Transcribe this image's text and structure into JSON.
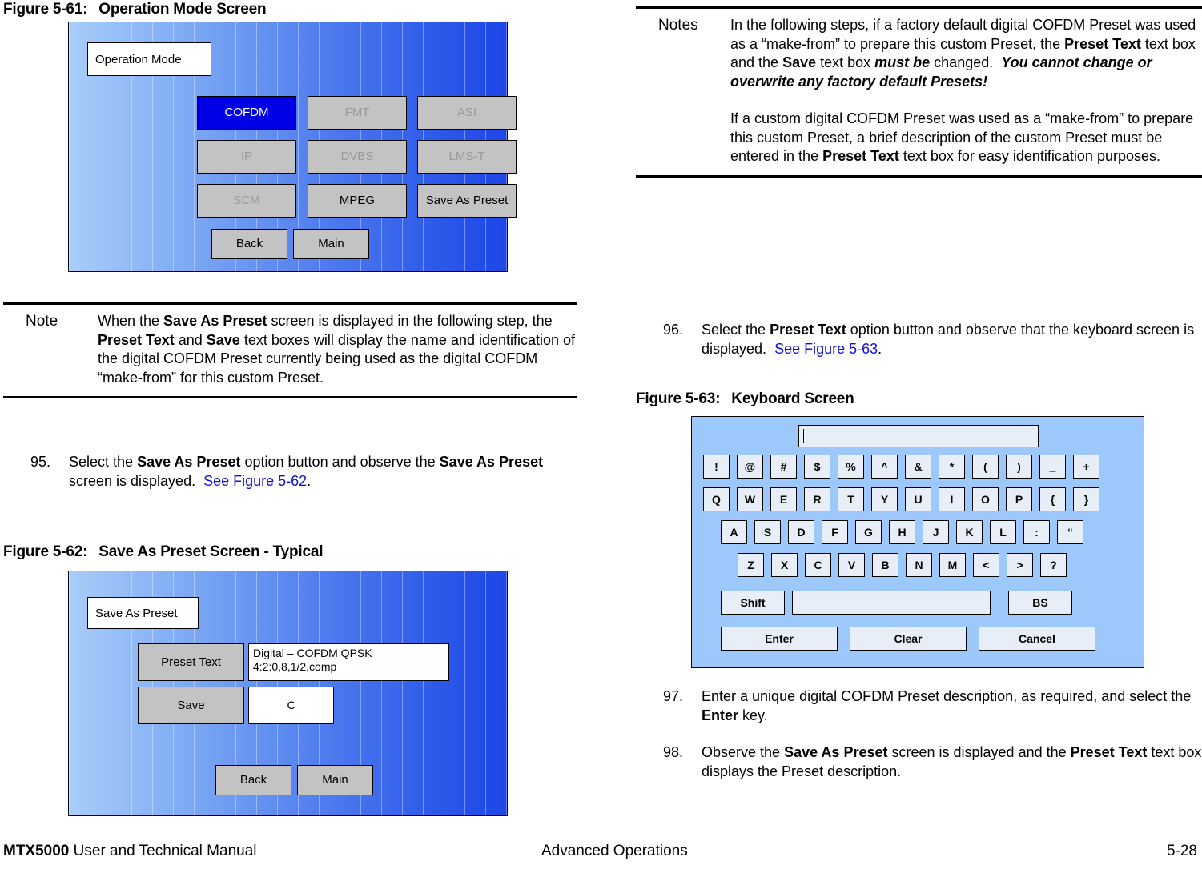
{
  "figures": {
    "fig61": {
      "caption_num": "Figure 5-61:",
      "caption_text": "Operation Mode Screen",
      "title": "Operation Mode",
      "buttons": [
        {
          "label": "COFDM",
          "state": "selected"
        },
        {
          "label": "FMT",
          "state": "disabled"
        },
        {
          "label": "ASI",
          "state": "disabled"
        },
        {
          "label": "IP",
          "state": "disabled"
        },
        {
          "label": "DVBS",
          "state": "disabled"
        },
        {
          "label": "LMS-T",
          "state": "disabled"
        },
        {
          "label": "SCM",
          "state": "disabled"
        },
        {
          "label": "MPEG",
          "state": "enabled"
        },
        {
          "label": "Save As Preset",
          "state": "enabled"
        }
      ],
      "nav": [
        {
          "label": "Back"
        },
        {
          "label": "Main"
        }
      ]
    },
    "fig62": {
      "caption_num": "Figure 5-62:",
      "caption_text": "Save As Preset Screen - Typical",
      "title": "Save As Preset",
      "preset_text_label": "Preset Text",
      "preset_text_value_line1": "Digital – COFDM QPSK",
      "preset_text_value_line2": "4:2:0,8,1/2,comp",
      "save_label": "Save",
      "save_value": "C",
      "nav": [
        {
          "label": "Back"
        },
        {
          "label": "Main"
        }
      ]
    },
    "fig63": {
      "caption_num": "Figure 5-63:",
      "caption_text": "Keyboard Screen",
      "input_value": "",
      "rows": [
        [
          "!",
          "@",
          "#",
          "$",
          "%",
          "^",
          "&",
          "*",
          "(",
          ")",
          "_",
          "+"
        ],
        [
          "Q",
          "W",
          "E",
          "R",
          "T",
          "Y",
          "U",
          "I",
          "O",
          "P",
          "{",
          "}"
        ],
        [
          "A",
          "S",
          "D",
          "F",
          "G",
          "H",
          "J",
          "K",
          "L",
          ":",
          "“"
        ],
        [
          "Z",
          "X",
          "C",
          "V",
          "B",
          "N",
          "M",
          "<",
          ">",
          "?"
        ]
      ],
      "shift_label": "Shift",
      "space_label": "",
      "bs_label": "BS",
      "enter_label": "Enter",
      "clear_label": "Clear",
      "cancel_label": "Cancel"
    }
  },
  "note_left": {
    "label": "Note",
    "html": "When the <b>Save As Preset</b> screen is displayed in the following step, the <b>Preset Text</b> and <b>Save</b> text boxes will display the name and identification of the digital COFDM Preset currently being used as the digital COFDM “make-from” for this custom Preset."
  },
  "notes_right": {
    "label": "Notes",
    "html_p1": "In the following steps, if a factory default digital COFDM Preset was used as a “make-from” to prepare this custom Preset, the <b>Preset Text</b> text box and the <b>Save</b> text box <b><i>must be</i></b> changed.&nbsp; <b><i>You cannot change or overwrite any factory default Presets!</i></b>",
    "html_p2": "If a custom digital COFDM Preset was used as a “make-from” to prepare this custom Preset, a brief description of the custom Preset must be entered in the <b>Preset Text</b> text box for easy identification purposes."
  },
  "steps": {
    "s95": {
      "num": "95.",
      "html": "Select the <b>Save As Preset</b> option button and observe the <b>Save As Preset</b> screen is displayed.&nbsp; <a class=\"xref\">See Figure 5-62</a>."
    },
    "s96": {
      "num": "96.",
      "html": "Select the <b>Preset Text</b> option button and observe that the keyboard screen is displayed.&nbsp; <a class=\"xref\">See Figure 5-63</a>."
    },
    "s97": {
      "num": "97.",
      "html": "Enter a unique digital COFDM Preset description, as required, and select the <b>Enter</b> key."
    },
    "s98": {
      "num": "98.",
      "html": "Observe the <b>Save As Preset</b> screen is displayed and the <b>Preset Text</b> text box displays the Preset description."
    }
  },
  "footer": {
    "manual_bold": "MTX5000",
    "manual_rest": " User and Technical Manual",
    "section": "Advanced Operations",
    "page": "5-28"
  }
}
